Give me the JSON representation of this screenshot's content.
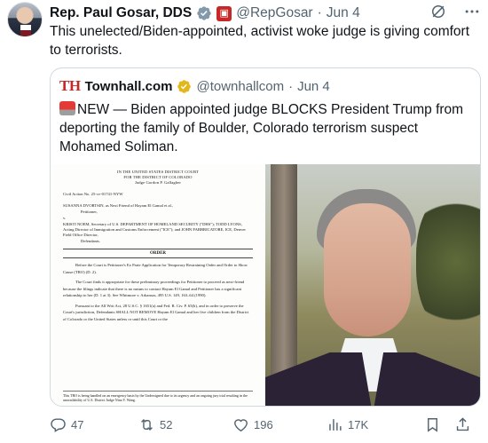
{
  "author": {
    "name": "Rep. Paul Gosar, DDS",
    "handle": "@RepGosar",
    "separator": "·",
    "date": "Jun 4"
  },
  "tweet_text": "This unelected/Biden-appointed, activist woke judge is giving comfort to terrorists.",
  "quote": {
    "logo": "TH",
    "name": "Townhall.com",
    "handle": "@townhallcom",
    "separator": "·",
    "date": "Jun 4",
    "text": "NEW — Biden appointed judge BLOCKS President Trump from deporting the family of Boulder, Colorado terrorism suspect Mohamed Soliman.",
    "document": {
      "court_line1": "IN THE UNITED STATES DISTRICT COURT",
      "court_line2": "FOR THE DISTRICT OF COLORADO",
      "court_line3": "Judge Gordon P. Gallagher",
      "case_no": "Civil Action No. 25-cv-01741-NYW",
      "petitioner": "SUSANNA DVORTSIN, as Next Friend of Hayam El Gamal et al.,",
      "petitioner_role": "Petitioner,",
      "v": "v.",
      "respondents": "KRISTI NOEM, Secretary of U.S. DEPARTMENT OF HOMELAND SECURITY (\"DHS\"); TODD LYONS, Acting Director of Immigration and Customs Enforcement (\"ICE\"); and JOHN FABBRICATORE, ICE, Denver Field Office Director,",
      "defendants": "Defendants.",
      "order_title": "ORDER",
      "para1": "Before the Court is Petitioner's Ex Parte Application for Temporary Restraining Order and Order to Show Cause (TRO) (D. 2).",
      "para2": "The Court finds it appropriate for these preliminary proceedings for Petitioner to proceed as next-friend because the filings indicate that there is no means to contact Hayam El Gamal and Petitioner has a significant relationship to her (D. 1 at 3). See Whitmore v. Arkansas, 495 U.S. 149, 163–64 (1990).",
      "para3": "Pursuant to the All Writ Act, 28 U.S.C. § 1651(a) and Fed. R. Civ. P. 65(b), and in order to preserve the Court's jurisdiction, Defendants SHALL NOT REMOVE Hayam El Gamal and her five children from the District of Colorado or the United States unless or until this Court or the",
      "footnote": "This TRO is being handled on an emergency basis by the Undersigned due to its urgency and an ongoing jury trial resulting in the unavailability of U.S. District Judge Nina Y. Wang."
    }
  },
  "actions": {
    "replies": "47",
    "reposts": "52",
    "likes": "196",
    "views": "17K"
  },
  "colors": {
    "text_primary": "#0f1419",
    "text_secondary": "#536471",
    "verified_blue": "#1d9bf0",
    "verified_gold": "#e2b719",
    "townhall_red": "#c62828",
    "border": "#cfd9de"
  },
  "icons": [
    "verified-badge-icon",
    "government-badge-icon",
    "grok-icon",
    "more-icon",
    "gold-check-icon",
    "red-siren-emoji-icon",
    "reply-icon",
    "repost-icon",
    "like-icon",
    "views-icon",
    "bookmark-icon",
    "share-icon"
  ]
}
